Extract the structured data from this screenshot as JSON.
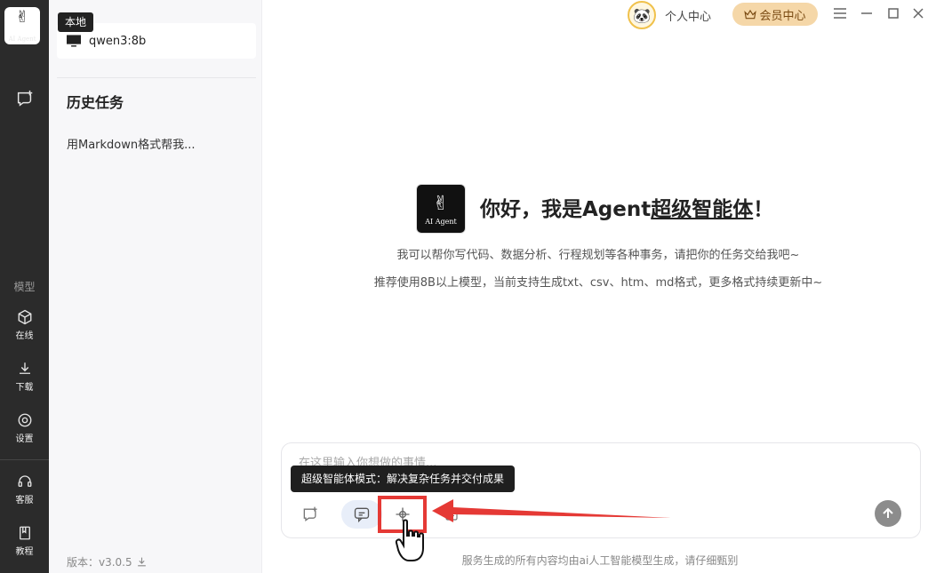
{
  "app": {
    "logo_caption": "AI Agent"
  },
  "rail": {
    "section_label": "模型",
    "items": [
      {
        "label": "在线",
        "icon": "cube-icon"
      },
      {
        "label": "下载",
        "icon": "download-icon"
      },
      {
        "label": "设置",
        "icon": "settings-icon"
      },
      {
        "label": "客服",
        "icon": "headset-icon"
      },
      {
        "label": "教程",
        "icon": "book-icon"
      }
    ]
  },
  "sidebar": {
    "local_badge": "本地",
    "model_name": "qwen3:8b",
    "history_title": "历史任务",
    "history_items": [
      "用Markdown格式帮我..."
    ],
    "version": "版本：v3.0.5"
  },
  "header": {
    "personal_center": "个人中心",
    "vip_center": "会员中心"
  },
  "welcome": {
    "title_prefix": "你好，我是Agent",
    "title_emph": "超级智能体",
    "title_suffix": "！",
    "line1": "我可以帮你写代码、数据分析、行程规划等各种事务，请把你的任务交给我吧~",
    "line2": "推荐使用8B以上模型，当前支持生成txt、csv、htm、md格式，更多格式持续更新中~"
  },
  "composer": {
    "placeholder": "在这里输入你想做的事情...",
    "tooltip": "超级智能体模式：解决复杂任务并交付成果"
  },
  "footer": {
    "note": "服务生成的所有内容均由ai人工智能模型生成，请仔细甄别"
  },
  "colors": {
    "accent_red": "#e53935",
    "vip_bg": "#f5d7a8",
    "rail_bg": "#2b2b2b"
  }
}
